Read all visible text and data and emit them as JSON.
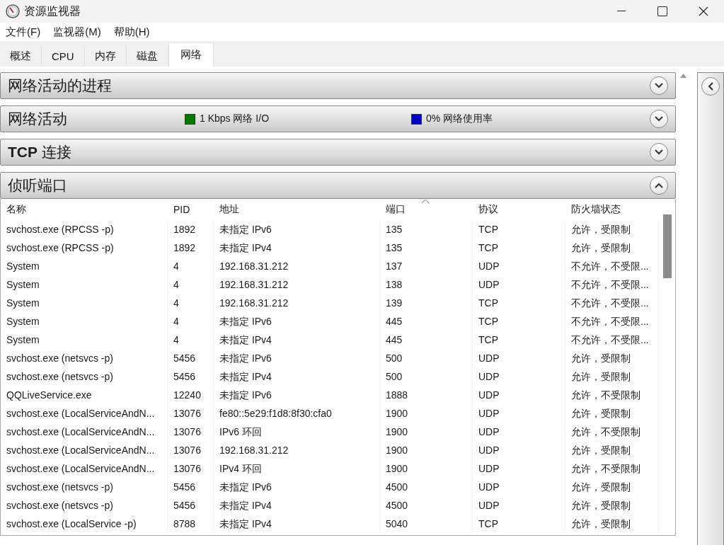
{
  "window": {
    "title": "资源监视器"
  },
  "menu": [
    "文件(F)",
    "监视器(M)",
    "帮助(H)"
  ],
  "tabs": [
    {
      "label": "概述",
      "selected": false
    },
    {
      "label": "CPU",
      "selected": false
    },
    {
      "label": "内存",
      "selected": false
    },
    {
      "label": "磁盘",
      "selected": false
    },
    {
      "label": "网络",
      "selected": true
    }
  ],
  "sections": [
    {
      "title": "网络活动的进程",
      "expanded": false
    },
    {
      "title": "网络活动",
      "expanded": false,
      "indicators": [
        {
          "label": "1 Kbps 网络 I/O",
          "color": "#007a00"
        },
        {
          "label": "0% 网络使用率",
          "color": "#0000c0"
        }
      ]
    },
    {
      "title": "**TCP** 连接",
      "expanded": false
    },
    {
      "title": "侦听端口",
      "expanded": true,
      "table": {
        "columns": [
          {
            "label": "名称",
            "sorted": false
          },
          {
            "label": "PID",
            "sorted": false
          },
          {
            "label": "地址",
            "sorted": false
          },
          {
            "label": "端口",
            "sorted": true
          },
          {
            "label": "协议",
            "sorted": false
          },
          {
            "label": "防火墙状态",
            "sorted": false
          }
        ],
        "rows": [
          [
            "svchost.exe (RPCSS -p)",
            "1892",
            "未指定 IPv6",
            "135",
            "TCP",
            "允许，受限制"
          ],
          [
            "svchost.exe (RPCSS -p)",
            "1892",
            "未指定 IPv4",
            "135",
            "TCP",
            "允许，受限制"
          ],
          [
            "System",
            "4",
            "192.168.31.212",
            "137",
            "UDP",
            "不允许，不受限..."
          ],
          [
            "System",
            "4",
            "192.168.31.212",
            "138",
            "UDP",
            "不允许，不受限..."
          ],
          [
            "System",
            "4",
            "192.168.31.212",
            "139",
            "TCP",
            "不允许，不受限..."
          ],
          [
            "System",
            "4",
            "未指定 IPv6",
            "445",
            "TCP",
            "不允许，不受限..."
          ],
          [
            "System",
            "4",
            "未指定 IPv4",
            "445",
            "TCP",
            "不允许，不受限..."
          ],
          [
            "svchost.exe (netsvcs -p)",
            "5456",
            "未指定 IPv6",
            "500",
            "UDP",
            "允许，受限制"
          ],
          [
            "svchost.exe (netsvcs -p)",
            "5456",
            "未指定 IPv4",
            "500",
            "UDP",
            "允许，受限制"
          ],
          [
            "QQLiveService.exe",
            "12240",
            "未指定 IPv6",
            "1888",
            "UDP",
            "允许，不受限制"
          ],
          [
            "svchost.exe (LocalServiceAndN...",
            "13076",
            "fe80::5e29:f1d8:8f30:cfa0",
            "1900",
            "UDP",
            "允许，受限制"
          ],
          [
            "svchost.exe (LocalServiceAndN...",
            "13076",
            "IPv6 环回",
            "1900",
            "UDP",
            "允许，不受限制"
          ],
          [
            "svchost.exe (LocalServiceAndN...",
            "13076",
            "192.168.31.212",
            "1900",
            "UDP",
            "允许，受限制"
          ],
          [
            "svchost.exe (LocalServiceAndN...",
            "13076",
            "IPv4 环回",
            "1900",
            "UDP",
            "允许，不受限制"
          ],
          [
            "svchost.exe (netsvcs -p)",
            "5456",
            "未指定 IPv6",
            "4500",
            "UDP",
            "允许，受限制"
          ],
          [
            "svchost.exe (netsvcs -p)",
            "5456",
            "未指定 IPv4",
            "4500",
            "UDP",
            "允许，受限制"
          ],
          [
            "svchost.exe (LocalService -p)",
            "8788",
            "未指定 IPv4",
            "5040",
            "TCP",
            "允许，受限制"
          ]
        ]
      }
    }
  ]
}
